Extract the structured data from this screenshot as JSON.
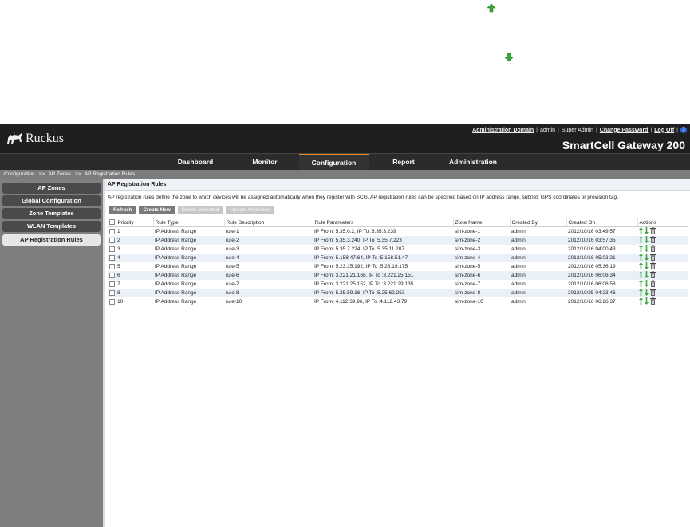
{
  "app": {
    "logo_text": "Ruckus",
    "product_name": "SmartCell Gateway 200",
    "top_links": {
      "admin_domain": "Administration Domain",
      "user": "admin",
      "role": "Super Admin",
      "change_password": "Change Password",
      "logoff": "Log Off",
      "help": "?"
    }
  },
  "nav": {
    "tabs": [
      {
        "label": "Dashboard"
      },
      {
        "label": "Monitor"
      },
      {
        "label": "Configuration"
      },
      {
        "label": "Report"
      },
      {
        "label": "Administration"
      }
    ],
    "active": "Configuration"
  },
  "breadcrumb": [
    "Configuration",
    "AP Zones",
    "AP Registration Rules"
  ],
  "breadcrumb_sep": ">>",
  "sidebar": {
    "items": [
      {
        "label": "AP Zones"
      },
      {
        "label": "Global Configuration"
      },
      {
        "label": "Zone Templates"
      },
      {
        "label": "WLAN Templates"
      },
      {
        "label": "AP Registration Rules"
      }
    ]
  },
  "main": {
    "title": "AP Registration Rules",
    "description": "AP registration rules define the zone to which devices will be assigned automatically when they register with SCG. AP registration rules can be specified based on IP address range, subnet, GPS coordinates or provision tag.",
    "buttons": {
      "refresh": "Refresh",
      "create": "Create New",
      "delete": "Delete Selected",
      "update": "Update Priorities"
    },
    "table": {
      "columns": [
        "Priority",
        "Rule Type",
        "Rule Description",
        "Rule Parameters",
        "Zone Name",
        "Created By",
        "Created On",
        "Actions"
      ],
      "rows": [
        {
          "priority": "1",
          "type": "IP Address Range",
          "desc": "rule-1",
          "params": "IP From: 5.35.0.2, IP To :5.35.3.239",
          "zone": "sim-zone-1",
          "by": "admin",
          "on": "2012/10/16 03:49:57"
        },
        {
          "priority": "2",
          "type": "IP Address Range",
          "desc": "rule-2",
          "params": "IP From: 5.35.3.240, IP To :5.35.7.223",
          "zone": "sim-zone-2",
          "by": "admin",
          "on": "2012/10/16 03:57:35"
        },
        {
          "priority": "3",
          "type": "IP Address Range",
          "desc": "rule-3",
          "params": "IP From: 5.35.7.224, IP To :5.35.11.207",
          "zone": "sim-zone-3",
          "by": "admin",
          "on": "2012/10/16 04:00:43"
        },
        {
          "priority": "4",
          "type": "IP Address Range",
          "desc": "rule-4",
          "params": "IP From: 5.158.47.64, IP To :5.158.51.47",
          "zone": "sim-zone-4",
          "by": "admin",
          "on": "2012/10/18 05:03:21"
        },
        {
          "priority": "5",
          "type": "IP Address Range",
          "desc": "rule-5",
          "params": "IP From: 5.23.15.192, IP To :5.23.19.175",
          "zone": "sim-zone-5",
          "by": "admin",
          "on": "2012/10/16 05:36:19"
        },
        {
          "priority": "6",
          "type": "IP Address Range",
          "desc": "rule-6",
          "params": "IP From: 3.221.21.168, IP To :3.221.25.151",
          "zone": "sim-zone-6",
          "by": "admin",
          "on": "2012/10/16 06:06:34"
        },
        {
          "priority": "7",
          "type": "IP Address Range",
          "desc": "rule-7",
          "params": "IP From: 3.221.25.152, IP To :3.221.29.135",
          "zone": "sim-zone-7",
          "by": "admin",
          "on": "2012/10/16 06:06:58"
        },
        {
          "priority": "8",
          "type": "IP Address Range",
          "desc": "rule-8",
          "params": "IP From: 5.25.59.16, IP To :5.25.62.253",
          "zone": "sim-zone-8",
          "by": "admin",
          "on": "2012/10/25 04:23:46"
        },
        {
          "priority": "10",
          "type": "IP Address Range",
          "desc": "rule-10",
          "params": "IP From: 4.112.39.96, IP To :4.112.43.79",
          "zone": "sim-zone-10",
          "by": "admin",
          "on": "2012/10/16 06:26:37"
        }
      ]
    }
  },
  "icons": {
    "move_up": "arrow-up-icon",
    "move_down": "arrow-down-icon",
    "delete": "trash-icon"
  },
  "colors": {
    "accent": "#e98a2b",
    "arrow_green": "#3aa83a",
    "topbar": "#1f1f1f",
    "row_alt": "#eaf0f8"
  }
}
